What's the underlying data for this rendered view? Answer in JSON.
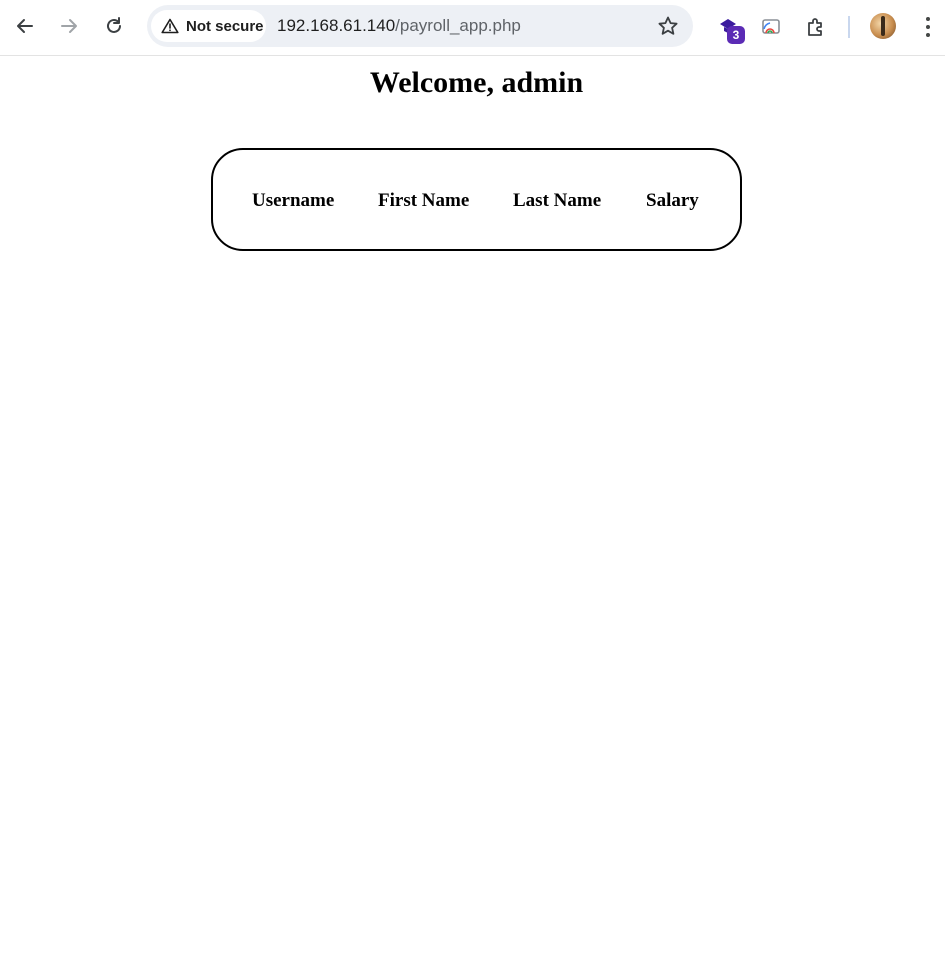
{
  "browser": {
    "security_chip": "Not secure",
    "url_host": "192.168.61.140",
    "url_path": "/payroll_app.php",
    "extension_badge": "3",
    "icons": [
      "back-arrow-icon",
      "forward-arrow-icon",
      "reload-icon",
      "warning-icon",
      "star-icon",
      "extension-icon",
      "cast-icon",
      "puzzle-icon",
      "avatar",
      "kebab-menu-icon"
    ],
    "accent": "#5b2bb5"
  },
  "page": {
    "title": "Welcome, admin",
    "table": {
      "headers": [
        "Username",
        "First Name",
        "Last Name",
        "Salary"
      ],
      "rows": []
    }
  }
}
